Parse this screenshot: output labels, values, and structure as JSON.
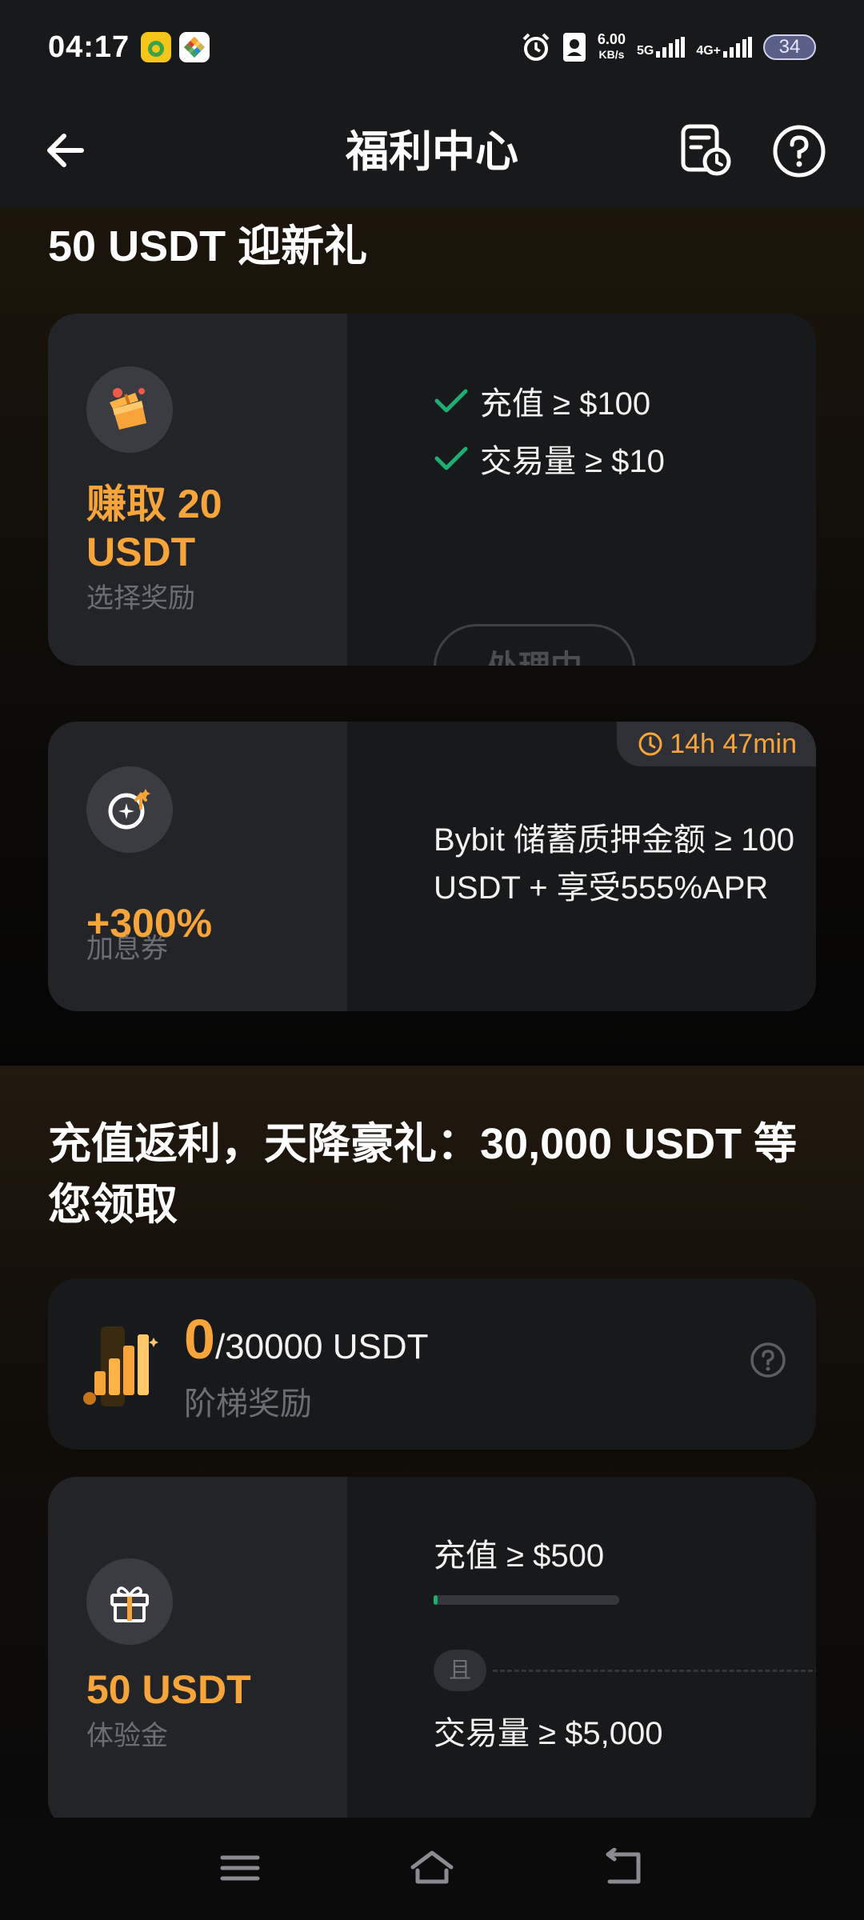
{
  "status_bar": {
    "time": "04:17",
    "speed_value": "6.00",
    "speed_unit": "KB/s",
    "net_5g": "5G",
    "net_4g": "4G+",
    "battery": "34"
  },
  "header": {
    "title": "福利中心",
    "icons": [
      "back-arrow-icon",
      "record-clock-icon",
      "help-icon"
    ]
  },
  "welcome_section": {
    "title": "50 USDT 迎新礼",
    "card1": {
      "reward_value": "赚取 20 USDT",
      "reward_sub": "选择奖励",
      "conditions": [
        "充值 ≥ $100",
        "交易量 ≥ $10"
      ],
      "button_label": "处理中"
    },
    "card2": {
      "timer": "14h 47min",
      "reward_value": "+300%",
      "reward_sub": "加息券",
      "description": "Bybit 储蓄质押金额 ≥ 100 USDT + 享受555%APR"
    }
  },
  "deposit_section": {
    "title": "充值返利，天降豪礼：30,000 USDT 等您领取",
    "ladder": {
      "current": "0",
      "total": "/30000 USDT",
      "sub": "阶梯奖励"
    },
    "trial_card": {
      "reward_value": "50 USDT",
      "reward_sub": "体验金",
      "condition1": "充值 ≥ $500",
      "condition1_progress": 0.02,
      "and_label": "且",
      "condition2": "交易量 ≥ $5,000"
    }
  },
  "colors": {
    "accent_orange": "#f7a43a",
    "success_green": "#1fae72",
    "card_bg": "#18191b"
  }
}
